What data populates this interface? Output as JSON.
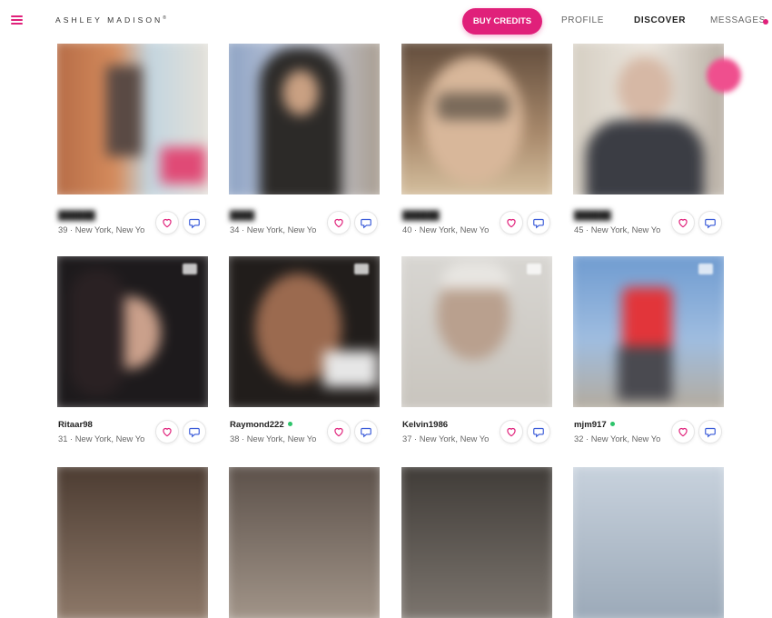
{
  "header": {
    "menu_icon": "hamburger-menu-icon",
    "logo_text": "ASHLEY MADISON",
    "logo_mark": "®",
    "buy_credits_label": "BUY CREDITS",
    "nav": {
      "profile": "PROFILE",
      "discover": "DISCOVER",
      "messages": "MESSAGES"
    },
    "brand_color": "#e0207a"
  },
  "profiles_row1": [
    {
      "name": "",
      "meta": "39 · New York, New Yo"
    },
    {
      "name": "",
      "meta": "34 · New York, New Yo"
    },
    {
      "name": "",
      "meta": "40 · New York, New Yo"
    },
    {
      "name": "",
      "meta": "45 · New York, New Yo"
    }
  ],
  "profiles_row2": [
    {
      "name": "Ritaar98",
      "meta": "31 · New York, New Yo",
      "online": false
    },
    {
      "name": "Raymond222",
      "meta": "38 · New York, New Yo",
      "online": true
    },
    {
      "name": "Kelvin1986",
      "meta": "37 · New York, New Yo",
      "online": false
    },
    {
      "name": "mjm917",
      "meta": "32 · New York, New Yo",
      "online": true
    }
  ],
  "icons": {
    "like": "heart-icon",
    "message": "chat-bubble-icon",
    "online_color": "#2ec46b"
  }
}
